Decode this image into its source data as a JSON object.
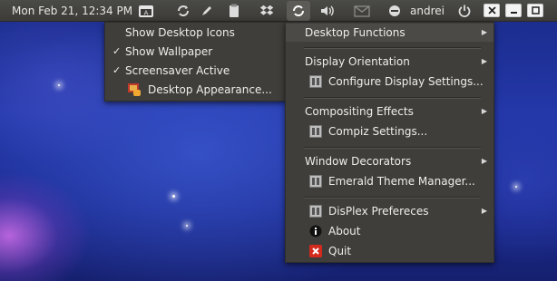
{
  "panel": {
    "clock": "Mon Feb 21, 12:34 PM",
    "user": "andrei",
    "indicators": [
      "calendar-icon",
      "refresh-icon",
      "pen-icon",
      "clipboard-icon",
      "dropbox-icon",
      "swirl-icon",
      "volume-icon",
      "mail-icon",
      "chat-icon",
      "power-icon"
    ],
    "window_buttons": [
      "close-icon",
      "minimize-icon",
      "maximize-icon"
    ]
  },
  "left_menu": {
    "items": [
      {
        "label": "Show Desktop Icons",
        "checked": false
      },
      {
        "label": "Show Wallpaper",
        "checked": true
      },
      {
        "label": "Screensaver Active",
        "checked": true
      },
      {
        "label": "Desktop Appearance...",
        "icon": "appearance-icon"
      }
    ]
  },
  "right_menu": {
    "items": [
      {
        "label": "Desktop Functions",
        "submenu": true
      },
      {
        "label": "Display Orientation",
        "submenu": true
      },
      {
        "label": "Configure Display Settings...",
        "icon": "settings-icon"
      },
      {
        "label": "Compositing Effects",
        "submenu": true
      },
      {
        "label": "Compiz Settings...",
        "icon": "settings-icon"
      },
      {
        "label": "Window Decorators",
        "submenu": true
      },
      {
        "label": "Emerald Theme Manager...",
        "icon": "settings-icon"
      },
      {
        "label": "DisPlex Prefereces",
        "icon": "settings-icon",
        "submenu": true
      },
      {
        "label": "About",
        "icon": "info-icon"
      },
      {
        "label": "Quit",
        "icon": "quit-icon"
      }
    ]
  },
  "symbols": {
    "check": "✓",
    "arrow": "▶"
  },
  "colors": {
    "panel": "#3c3b37",
    "menu": "#3f3e3a",
    "quit_red": "#d42a1e"
  }
}
